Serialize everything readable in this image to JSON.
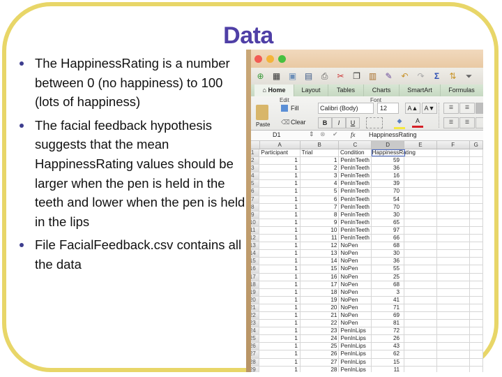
{
  "slide": {
    "title": "Data",
    "bullets": [
      "The HappinessRating is a number between 0 (no happiness) to 100 (lots of happiness)",
      "The facial feedback hypothesis suggests that the mean HappinessRating values should be larger when the pen is held in the teeth and lower when the pen is held in the lips",
      "File FacialFeedback.csv contains all the data"
    ],
    "colors": {
      "title": "#4f3fa6",
      "frame": "#e8d668",
      "bullet": "#3d3d8f"
    }
  },
  "excel": {
    "window_controls": [
      "close",
      "minimize",
      "zoom"
    ],
    "toolbar_icons": [
      "new-icon",
      "templates-icon",
      "open-icon",
      "save-icon",
      "print-icon",
      "cut-icon",
      "copy-icon",
      "paste-icon",
      "format-painter-icon",
      "undo-icon",
      "redo-icon",
      "autosum-icon",
      "sort-icon",
      "filter-icon"
    ],
    "tabs": [
      "Home",
      "Layout",
      "Tables",
      "Charts",
      "SmartArt",
      "Formulas"
    ],
    "active_tab": "Home",
    "ribbon": {
      "edit_group": "Edit",
      "font_group": "Font",
      "paste_label": "Paste",
      "fill_label": "Fill",
      "clear_label": "Clear",
      "font_name": "Calibri (Body)",
      "font_size": "12",
      "bold": "B",
      "italic": "I",
      "underline": "U",
      "grow_font": "A▲",
      "shrink_font": "A▼",
      "font_color": "A",
      "highlight_color": "#f4e842",
      "text_color": "#d62027"
    },
    "formula_bar": {
      "cell_ref": "D1",
      "fx": "fx",
      "content": "HappinessRating"
    },
    "columns": [
      "A",
      "B",
      "C",
      "D",
      "E",
      "F",
      "G"
    ],
    "headers": [
      "Participant",
      "Trial",
      "Condition",
      "HappinessRating"
    ],
    "rows": [
      [
        "1",
        "1",
        "PenInTeeth",
        "59"
      ],
      [
        "1",
        "2",
        "PenInTeeth",
        "36"
      ],
      [
        "1",
        "3",
        "PenInTeeth",
        "16"
      ],
      [
        "1",
        "4",
        "PenInTeeth",
        "39"
      ],
      [
        "1",
        "5",
        "PenInTeeth",
        "70"
      ],
      [
        "1",
        "6",
        "PenInTeeth",
        "54"
      ],
      [
        "1",
        "7",
        "PenInTeeth",
        "70"
      ],
      [
        "1",
        "8",
        "PenInTeeth",
        "30"
      ],
      [
        "1",
        "9",
        "PenInTeeth",
        "65"
      ],
      [
        "1",
        "10",
        "PenInTeeth",
        "97"
      ],
      [
        "1",
        "11",
        "PenInTeeth",
        "66"
      ],
      [
        "1",
        "12",
        "NoPen",
        "68"
      ],
      [
        "1",
        "13",
        "NoPen",
        "30"
      ],
      [
        "1",
        "14",
        "NoPen",
        "36"
      ],
      [
        "1",
        "15",
        "NoPen",
        "55"
      ],
      [
        "1",
        "16",
        "NoPen",
        "25"
      ],
      [
        "1",
        "17",
        "NoPen",
        "68"
      ],
      [
        "1",
        "18",
        "NoPen",
        "3"
      ],
      [
        "1",
        "19",
        "NoPen",
        "41"
      ],
      [
        "1",
        "20",
        "NoPen",
        "71"
      ],
      [
        "1",
        "21",
        "NoPen",
        "69"
      ],
      [
        "1",
        "22",
        "NoPen",
        "81"
      ],
      [
        "1",
        "23",
        "PenInLips",
        "72"
      ],
      [
        "1",
        "24",
        "PenInLips",
        "26"
      ],
      [
        "1",
        "25",
        "PenInLips",
        "43"
      ],
      [
        "1",
        "26",
        "PenInLips",
        "62"
      ],
      [
        "1",
        "27",
        "PenInLips",
        "15"
      ],
      [
        "1",
        "28",
        "PenInLips",
        "11"
      ]
    ]
  }
}
